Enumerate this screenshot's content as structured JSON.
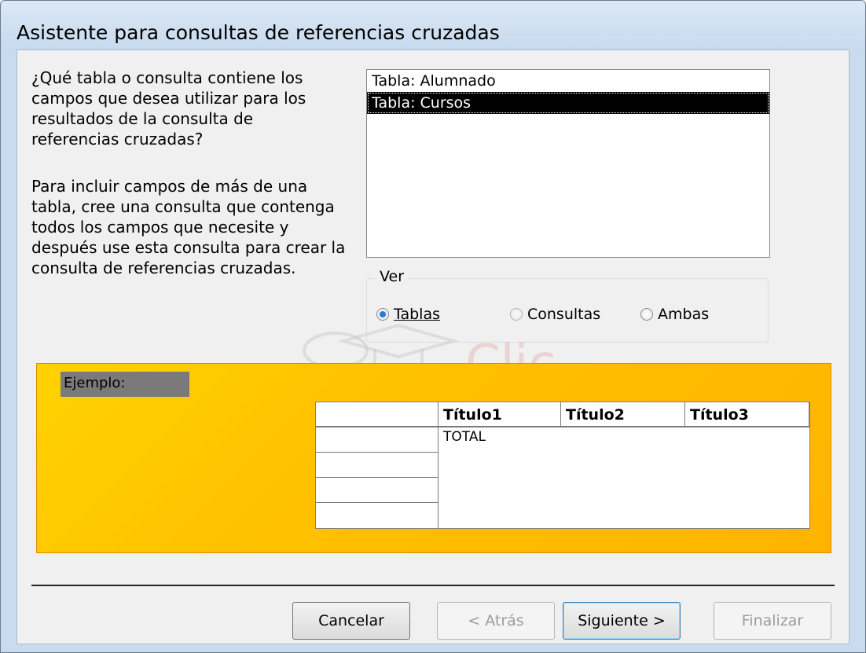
{
  "window": {
    "title": "Asistente para consultas de referencias cruzadas"
  },
  "instructions": {
    "question": "¿Qué tabla o consulta contiene los campos que desea utilizar para los resultados de la consulta de referencias cruzadas?",
    "hint": "Para incluir campos de más de una tabla, cree una consulta que contenga todos los campos que necesite y después use esta consulta para crear la consulta de referencias cruzadas."
  },
  "list": {
    "items": [
      {
        "label": "Tabla: Alumnado",
        "selected": false
      },
      {
        "label": "Tabla: Cursos",
        "selected": true
      }
    ]
  },
  "view_group": {
    "label": "Ver",
    "options": [
      {
        "label": "Tablas",
        "checked": true
      },
      {
        "label": "Consultas",
        "checked": false
      },
      {
        "label": "Ambas",
        "checked": false
      }
    ]
  },
  "example": {
    "label": "Ejemplo:",
    "headers": [
      "",
      "Título1",
      "Título2",
      "Título3"
    ],
    "cell": "TOTAL"
  },
  "buttons": {
    "cancel": "Cancelar",
    "back": "< Atrás",
    "next": "Siguiente >",
    "finish": "Finalizar"
  },
  "colors": {
    "selection": "#000000",
    "example_bg": "#ffc400",
    "radio_on": "#2a7bd4"
  }
}
